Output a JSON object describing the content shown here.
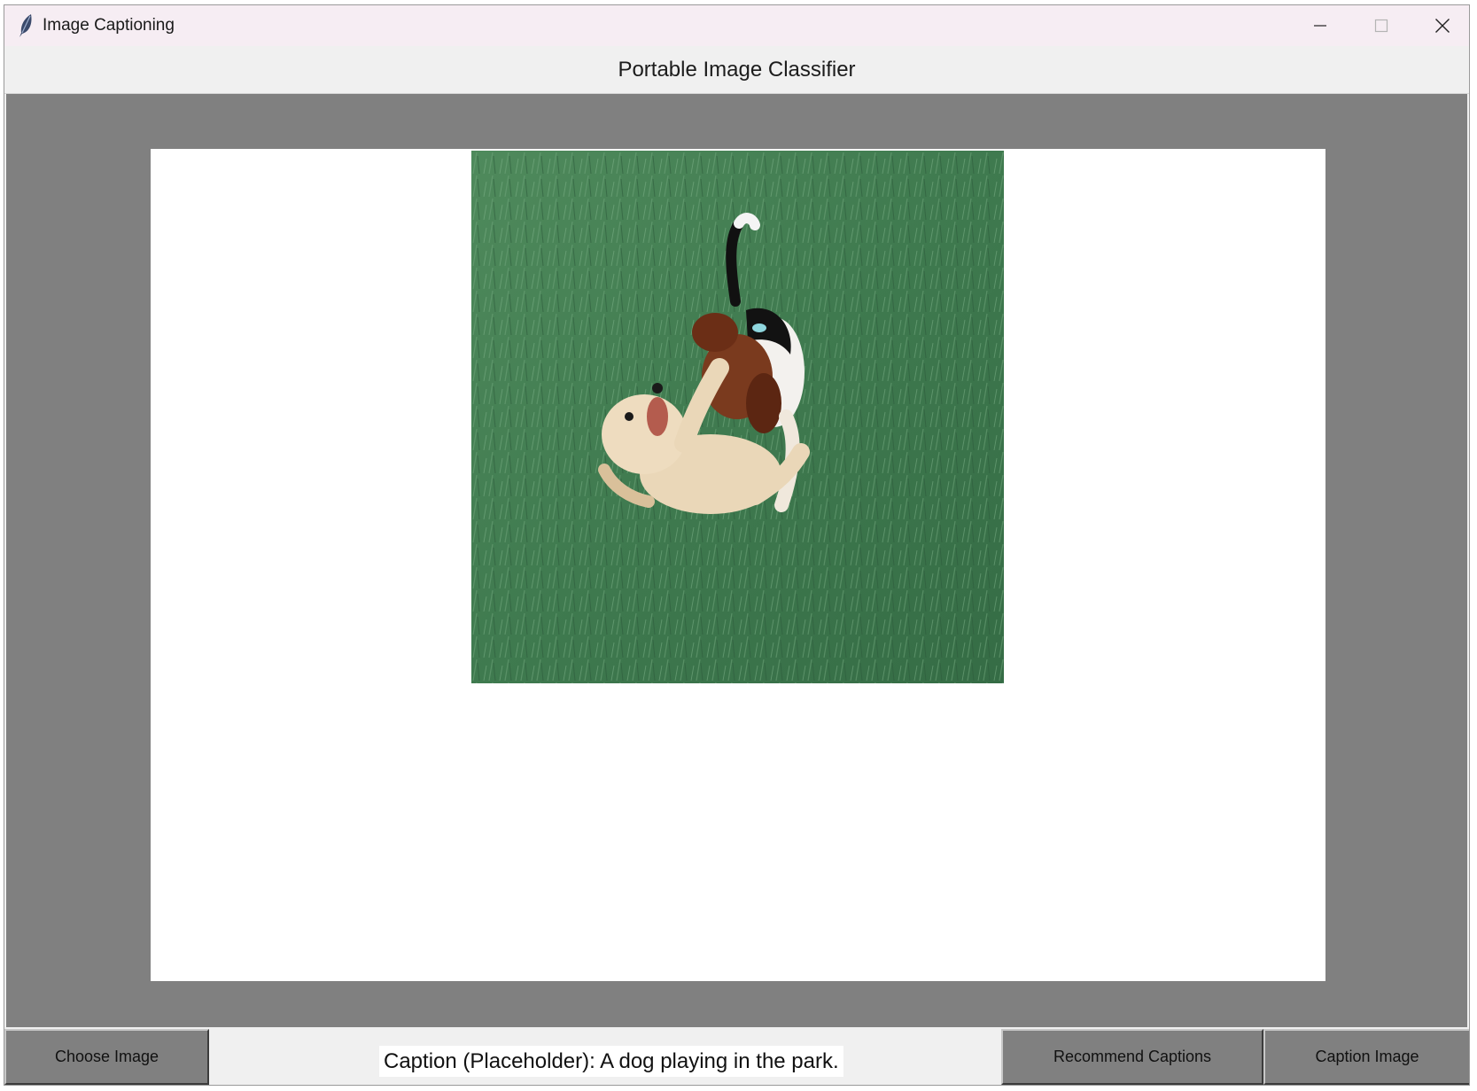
{
  "window": {
    "title": "Image Captioning",
    "icon": "feather-icon",
    "controls": [
      "minimize-icon",
      "maximize-icon",
      "close-icon"
    ]
  },
  "header": {
    "title": "Portable Image Classifier"
  },
  "canvas": {
    "image_subject": "puppies-playing-in-grass"
  },
  "bottom_bar": {
    "choose_label": "Choose Image",
    "caption_text": "Caption (Placeholder): A dog playing in the park.",
    "recommend_label": "Recommend Captions",
    "caption_label": "Caption Image"
  },
  "colors": {
    "stage_bg": "#808080",
    "button_bg": "#808080",
    "canvas_bg": "#ffffff",
    "titlebar_bg": "#f6edf3"
  }
}
